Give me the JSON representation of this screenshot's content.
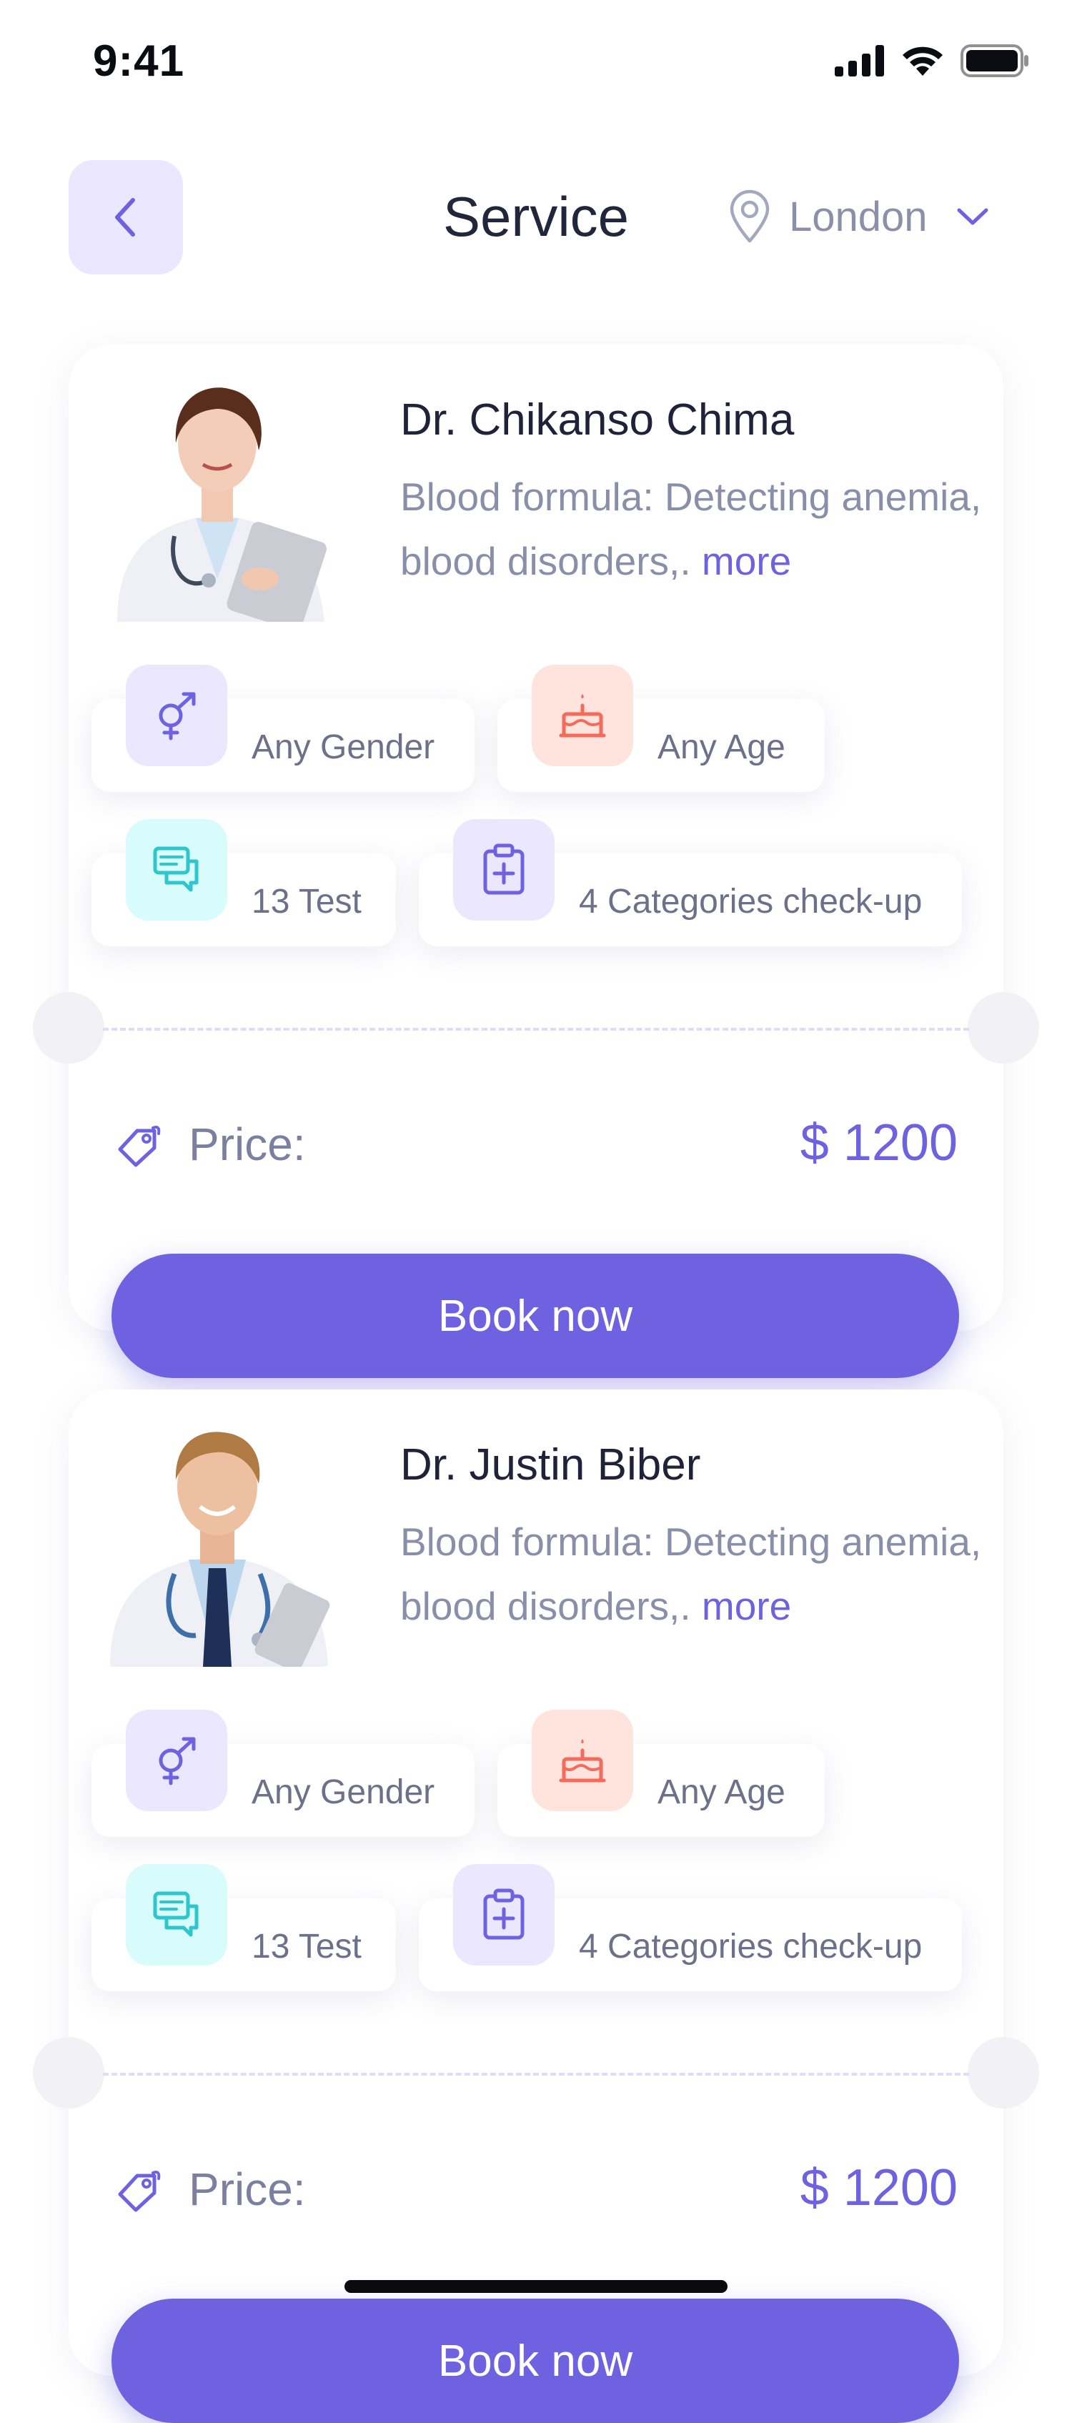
{
  "status_bar": {
    "time": "9:41"
  },
  "header": {
    "title": "Service",
    "location": "London"
  },
  "cards": [
    {
      "name": "Dr. Chikanso Chima",
      "description": "Blood formula: Detecting anemia, blood disorders,.",
      "more": "more",
      "chips": {
        "gender": "Any Gender",
        "age": "Any Age",
        "tests": "13 Test",
        "categories": "4 Categories check-up"
      },
      "price_label": "Price:",
      "price": "$ 1200",
      "book_label": "Book now"
    },
    {
      "name": "Dr. Justin Biber",
      "description": "Blood formula: Detecting anemia, blood disorders,.",
      "more": "more",
      "chips": {
        "gender": "Any Gender",
        "age": "Any Age",
        "tests": "13 Test",
        "categories": "4 Categories check-up"
      },
      "price_label": "Price:",
      "price": "$ 1200",
      "book_label": "Book now"
    }
  ],
  "icons": {
    "back": "chevron-left-icon",
    "location": "location-pin-icon",
    "dropdown": "chevron-down-icon",
    "gender": "gender-icon",
    "age": "cake-icon",
    "tests": "chat-icon",
    "categories": "clipboard-plus-icon",
    "price": "tag-icon"
  },
  "colors": {
    "accent": "#6e62e0",
    "accent_light": "#ebe7ff",
    "age_bg": "#ffe3dd",
    "age_icon": "#f36b5a",
    "tests_bg": "#d8fbfb",
    "tests_icon": "#2ec6cc",
    "text_muted": "#8a8fa9"
  }
}
